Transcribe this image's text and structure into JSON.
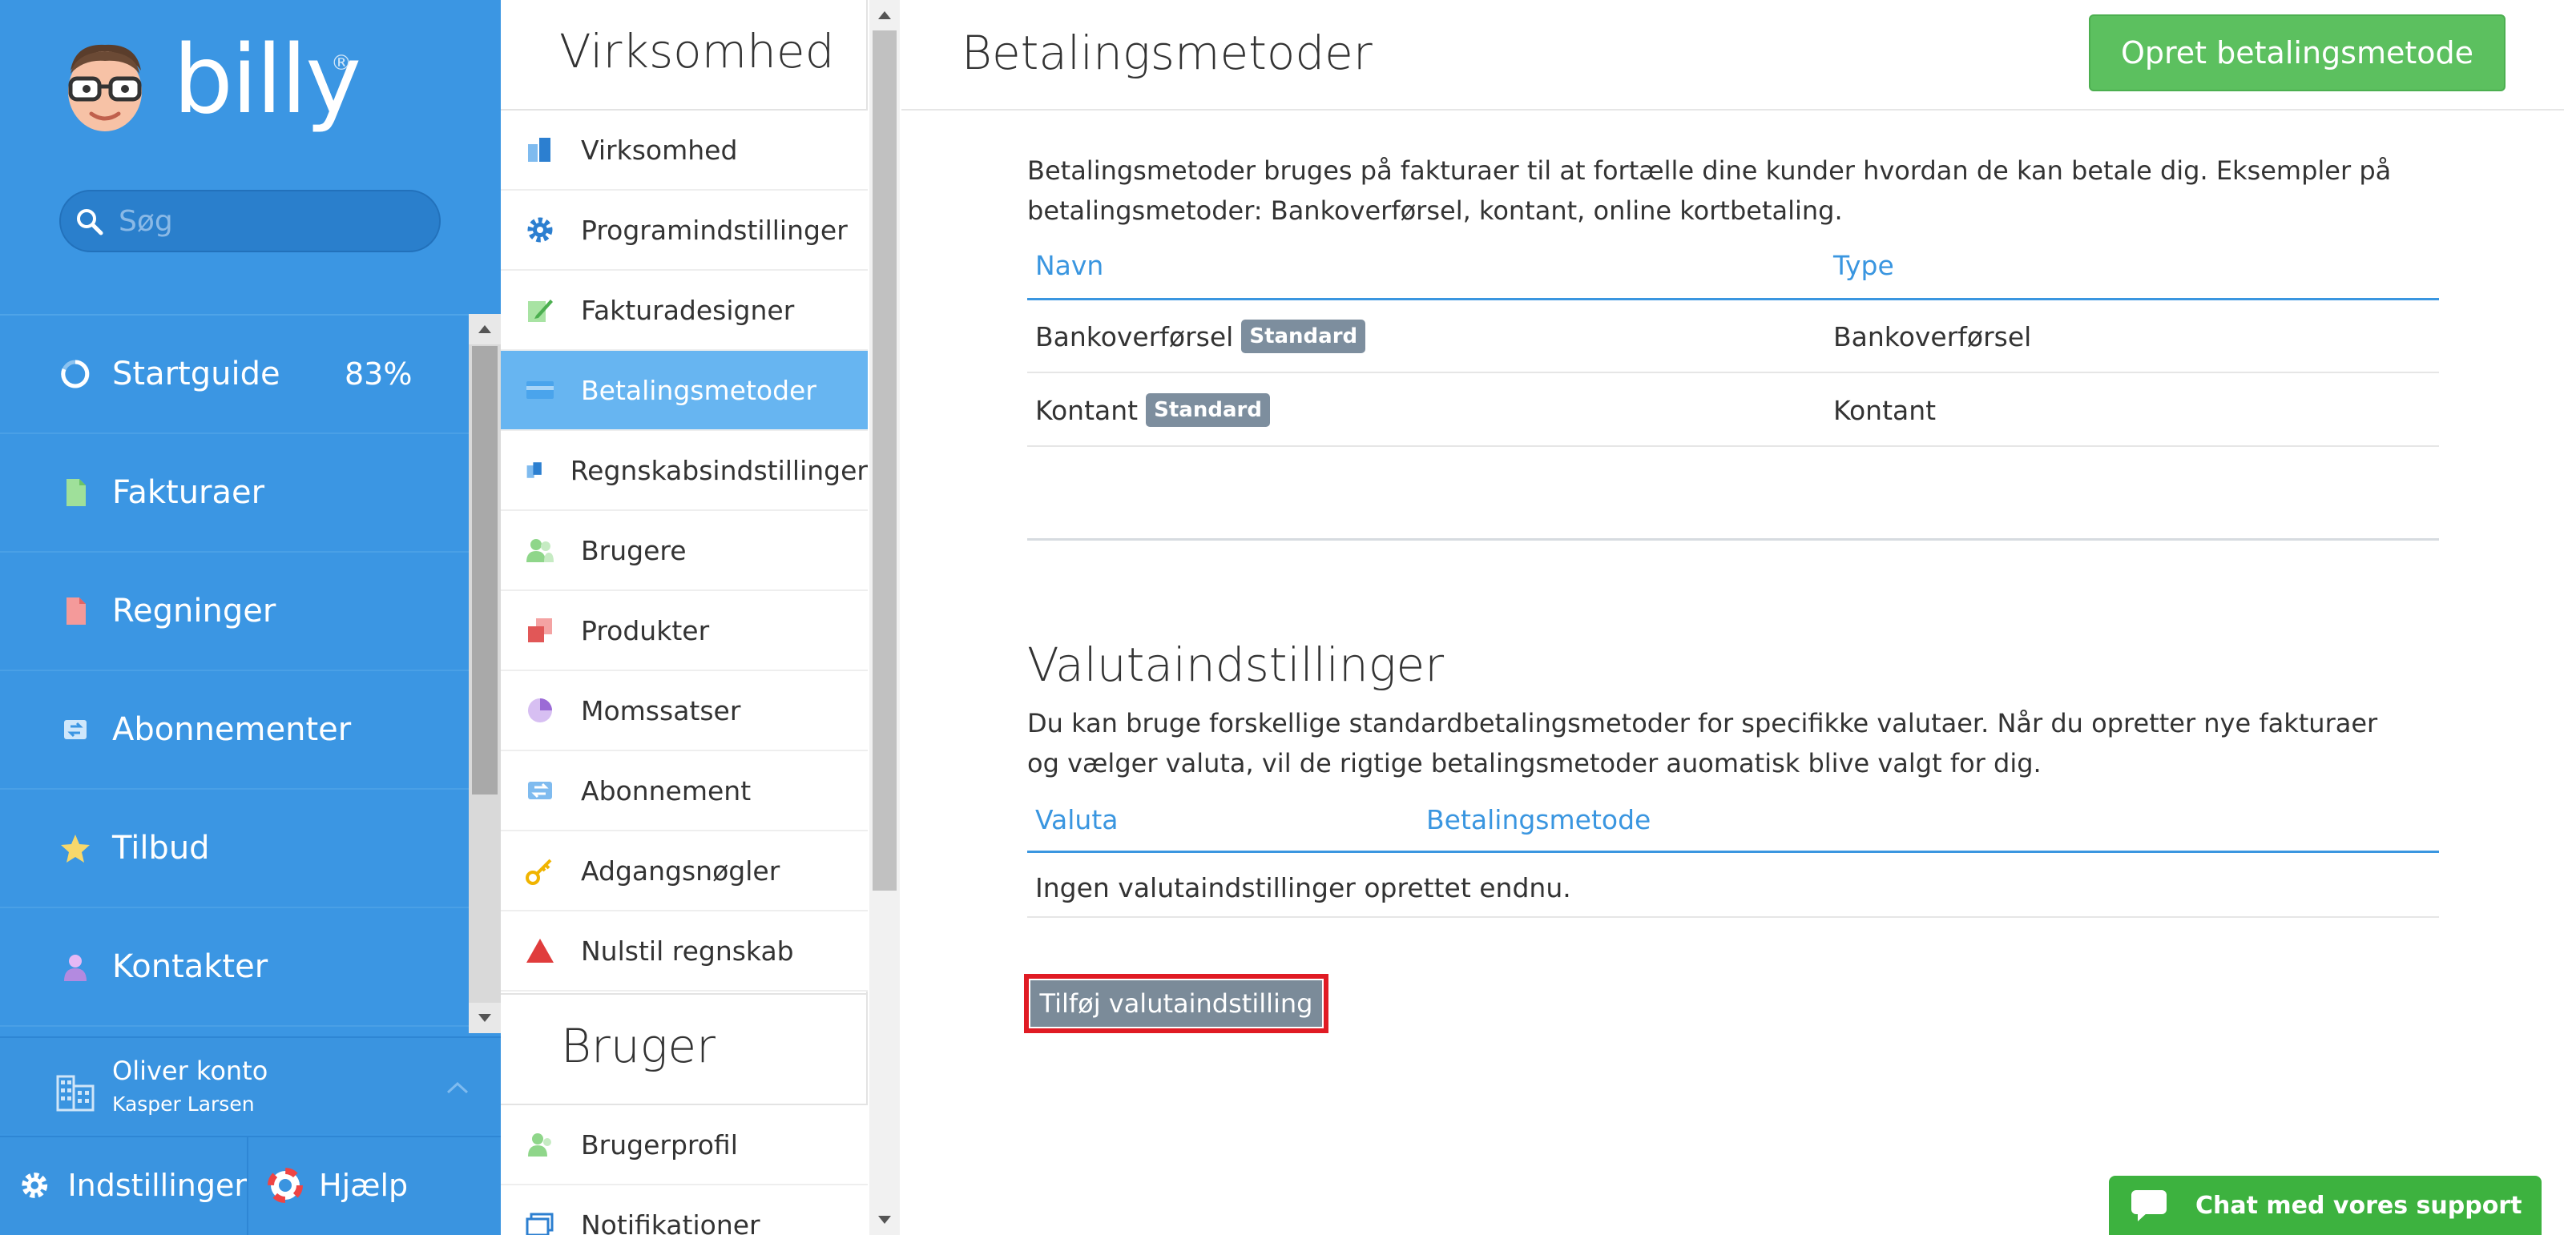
{
  "app": {
    "brand": "billy",
    "brand_mark": "®"
  },
  "search": {
    "placeholder": "Søg"
  },
  "nav": {
    "items": [
      {
        "label": "Startguide",
        "icon": "progress-ring-icon",
        "percent": "83%"
      },
      {
        "label": "Fakturaer",
        "icon": "invoice-icon"
      },
      {
        "label": "Regninger",
        "icon": "bill-icon"
      },
      {
        "label": "Abonnementer",
        "icon": "subscription-icon"
      },
      {
        "label": "Tilbud",
        "icon": "star-icon"
      },
      {
        "label": "Kontakter",
        "icon": "contact-icon"
      }
    ],
    "account": {
      "name": "Oliver konto",
      "user": "Kasper Larsen"
    },
    "settings_label": "Indstillinger",
    "help_label": "Hjælp"
  },
  "submenu": {
    "company_title": "Virksomhed",
    "company_items": [
      {
        "label": "Virksomhed",
        "icon": "company-icon"
      },
      {
        "label": "Programindstillinger",
        "icon": "gear-icon"
      },
      {
        "label": "Fakturadesigner",
        "icon": "designer-icon"
      },
      {
        "label": "Betalingsmetoder",
        "icon": "card-icon"
      },
      {
        "label": "Regnskabsindstillinger",
        "icon": "ledger-icon"
      },
      {
        "label": "Brugere",
        "icon": "users-icon"
      },
      {
        "label": "Produkter",
        "icon": "products-icon"
      },
      {
        "label": "Momssatser",
        "icon": "pie-icon"
      },
      {
        "label": "Abonnement",
        "icon": "subscription-icon"
      },
      {
        "label": "Adgangsnøgler",
        "icon": "key-icon"
      },
      {
        "label": "Nulstil regnskab",
        "icon": "warning-icon"
      }
    ],
    "user_title": "Bruger",
    "user_items": [
      {
        "label": "Brugerprofil",
        "icon": "user-icon"
      },
      {
        "label": "Notifikationer",
        "icon": "notification-icon"
      }
    ]
  },
  "main": {
    "title": "Betalingsmetoder",
    "create_button": "Opret betalingsmetode",
    "intro": "Betalingsmetoder bruges på fakturaer til at fortælle dine kunder hvordan de kan betale dig. Eksempler på betalingsmetoder: Bankoverførsel, kontant, online kortbetaling.",
    "payment_table": {
      "headers": [
        "Navn",
        "Type"
      ],
      "rows": [
        {
          "name": "Bankoverførsel",
          "badge": "Standard",
          "type": "Bankoverførsel"
        },
        {
          "name": "Kontant",
          "badge": "Standard",
          "type": "Kontant"
        }
      ]
    },
    "currency": {
      "title": "Valutaindstillinger",
      "text": "Du kan bruge forskellige standardbetalingsmetoder for specifikke valutaer. Når du opretter nye fakturaer og vælger valuta, vil de rigtige betalingsmetoder auomatisk blive valgt for dig.",
      "headers": [
        "Valuta",
        "Betalingsmetode"
      ],
      "empty": "Ingen valutaindstillinger oprettet endnu.",
      "add_button": "Tilføj valutaindstilling"
    }
  },
  "chat": {
    "label": "Chat med vores support"
  },
  "colors": {
    "nav_bg": "#3b96e3",
    "accent": "#3a96e0",
    "active_sub": "#67b5f1",
    "create_green": "#5cc05f",
    "badge_grey": "#7d8e9e",
    "highlight_red": "#e01b24",
    "chat_green": "#3db23f"
  }
}
